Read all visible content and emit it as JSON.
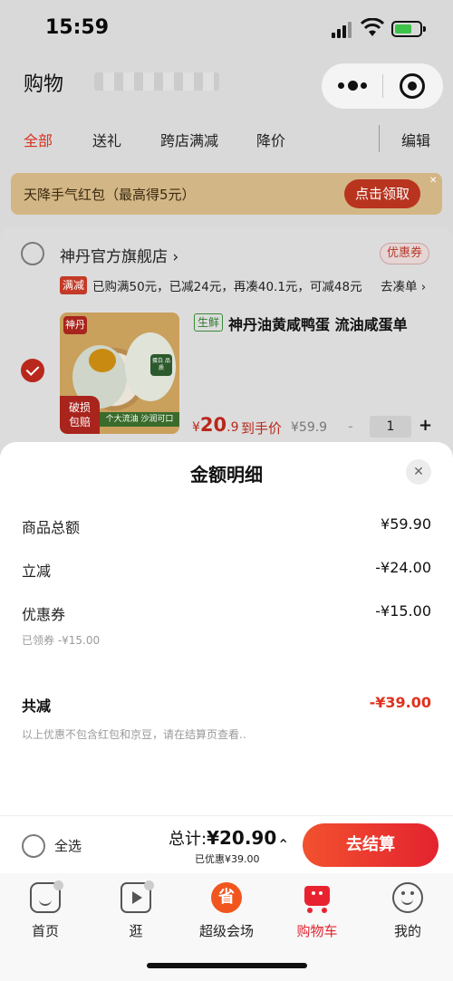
{
  "status": {
    "time": "15:59"
  },
  "nav": {
    "title": "购物"
  },
  "tabs": [
    {
      "label": "全部"
    },
    {
      "label": "送礼"
    },
    {
      "label": "跨店满减"
    },
    {
      "label": "降价"
    },
    {
      "label": "编辑"
    }
  ],
  "banner": {
    "text": "天降手气红包（最高得5元）",
    "button": "点击领取"
  },
  "shop": {
    "name": "神丹官方旗舰店 ›",
    "coupon_tag": "优惠券",
    "promo_tag": "满减",
    "promo_text": "已购满50元，已减24元，再凑40.1元，可减48元",
    "gather": "去凑单 ›"
  },
  "product": {
    "fresh_tag": "生鲜",
    "name": "神丹油黄咸鸭蛋 流油咸蛋单",
    "image": {
      "logo": "神丹",
      "badge_line1": "破损",
      "badge_line2": "包赔",
      "strip": "个大流油 沙润可口",
      "seal": "蛋白 品质"
    },
    "price_currency": "¥",
    "price_int": "20",
    "price_dec": ".9",
    "price_label": "到手价",
    "original_price": "¥59.9",
    "qty_minus": "-",
    "quantity": "1",
    "qty_plus": "+"
  },
  "sheet": {
    "title": "金额明细",
    "close": "✕",
    "rows": [
      {
        "label": "商品总额",
        "value": "¥59.90"
      },
      {
        "label": "立减",
        "value": "-¥24.00"
      },
      {
        "label": "优惠券",
        "value": "-¥15.00"
      }
    ],
    "coupon_note": "已领券 -¥15.00",
    "total_label": "共减",
    "total_value": "-¥39.00",
    "disclaimer": "以上优惠不包含红包和京豆，请在结算页查看.."
  },
  "checkout": {
    "select_all": "全选",
    "total_prefix": "总计:",
    "total_value": "¥20.90",
    "saved": "已优惠¥39.00",
    "chevron": "⌃",
    "button": "去结算"
  },
  "tabbar": [
    {
      "label": "首页",
      "icon": "home-icon"
    },
    {
      "label": "逛",
      "icon": "play-icon"
    },
    {
      "label": "超级会场",
      "icon": "super-venue-icon",
      "glyph": "省"
    },
    {
      "label": "购物车",
      "icon": "cart-icon"
    },
    {
      "label": "我的",
      "icon": "face-icon"
    }
  ],
  "colors": {
    "accent": "#e3232f",
    "price": "#b9281c",
    "discount": "#e0321e"
  }
}
